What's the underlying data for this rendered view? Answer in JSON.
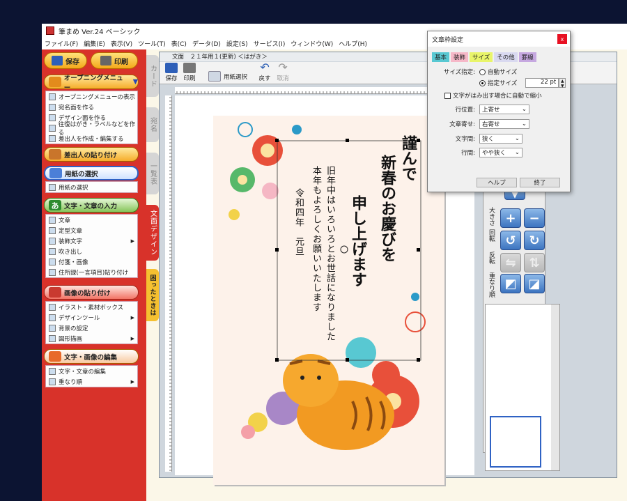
{
  "app": {
    "title": "筆まめ Ver.24 ベーシック"
  },
  "menu": [
    "ファイル(F)",
    "編集(E)",
    "表示(V)",
    "ツール(T)",
    "表(C)",
    "データ(D)",
    "設定(S)",
    "サービス(I)",
    "ウィンドウ(W)",
    "ヘルプ(H)"
  ],
  "left": {
    "save": "保存",
    "print": "印刷",
    "opening_menu": "オープニングメニュー",
    "opening_items": [
      "オープニングメニューの表示",
      "宛名面を作る",
      "デザイン面を作る",
      "往復はがき・ラベルなどを作る",
      "差出人を作成・編集する"
    ],
    "sender_paste": "差出人の貼り付け",
    "paper_select_head": "用紙の選択",
    "paper_select_item": "用紙の選択",
    "text_input_head": "文字・文章の入力",
    "text_items": [
      "文章",
      "定型文章",
      "装飾文字",
      "吹き出し",
      "付箋・画像",
      "住所録(一言項目)貼り付け"
    ],
    "image_paste_head": "画像の貼り付け",
    "image_items": [
      "イラスト・素材ボックス",
      "デザインツール",
      "背景の設定",
      "図形描画"
    ],
    "edit_head": "文字・画像の編集",
    "edit_items": [
      "文字・文章の編集",
      "重なり順"
    ]
  },
  "vtabs": {
    "card": "カード",
    "address": "宛名",
    "list": "一覧表",
    "design": "文面デザイン",
    "help": "困ったときは"
  },
  "doc": {
    "title": "文面　２１年用１(更新) ＜はがき＞",
    "toolbar": {
      "save": "保存",
      "print": "印刷",
      "paper": "用紙選択",
      "undo": "戻す",
      "redo": "取消"
    }
  },
  "card": {
    "greeting1": "謹んで",
    "greeting2": "新春のお慶びを",
    "greeting3": "申し上げます",
    "body1": "旧年中はいろいろとお世話になりました",
    "body2": "本年もよろしくお願いいたします",
    "date": "令和四年　元旦"
  },
  "rightpanel": {
    "size": "大きさ",
    "rotate": "回転",
    "flip": "反転",
    "order": "重なり順"
  },
  "dialog": {
    "title": "文章枠設定",
    "tabs": [
      "基本",
      "装飾",
      "サイズ",
      "その他",
      "罫線"
    ],
    "size_label": "サイズ指定:",
    "auto_size": "自動サイズ",
    "manual_size": "指定サイズ",
    "size_value": "22 pt",
    "shrink": "文字がはみ出す場合に自動で縮小",
    "line_pos_label": "行位置:",
    "line_pos": "上寄せ",
    "align_label": "文章寄せ:",
    "align": "右寄せ",
    "char_space_label": "文字間:",
    "char_space": "狭く",
    "line_space_label": "行間:",
    "line_space": "やや狭く",
    "help": "ヘルプ",
    "close": "終了"
  }
}
